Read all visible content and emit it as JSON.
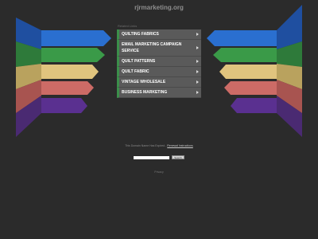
{
  "site": {
    "title": "rjrmarketing.org"
  },
  "related": {
    "label": "Related Links"
  },
  "links": [
    {
      "label": "QUILTING FABRICS"
    },
    {
      "label": "EMAIL MARKETING CAMPAIGN SERVICE"
    },
    {
      "label": "QUILT PATTERNS"
    },
    {
      "label": "QUILT FABRIC"
    },
    {
      "label": "VINTAGE WHOLESALE"
    },
    {
      "label": "BUSINESS MARKETING"
    }
  ],
  "footer": {
    "notice_text": "This Domain Name Has Expired - ",
    "notice_link": "Renewal Instructions",
    "search_placeholder": "",
    "search_button": "Search",
    "privacy": "Privacy"
  },
  "colors": {
    "background": "#2b2b2b",
    "ribbons": [
      "#1f5fb8",
      "#2e8a3e",
      "#c9b36a",
      "#b8605c",
      "#4d2a7a"
    ],
    "accent": "#3b8f4a"
  }
}
